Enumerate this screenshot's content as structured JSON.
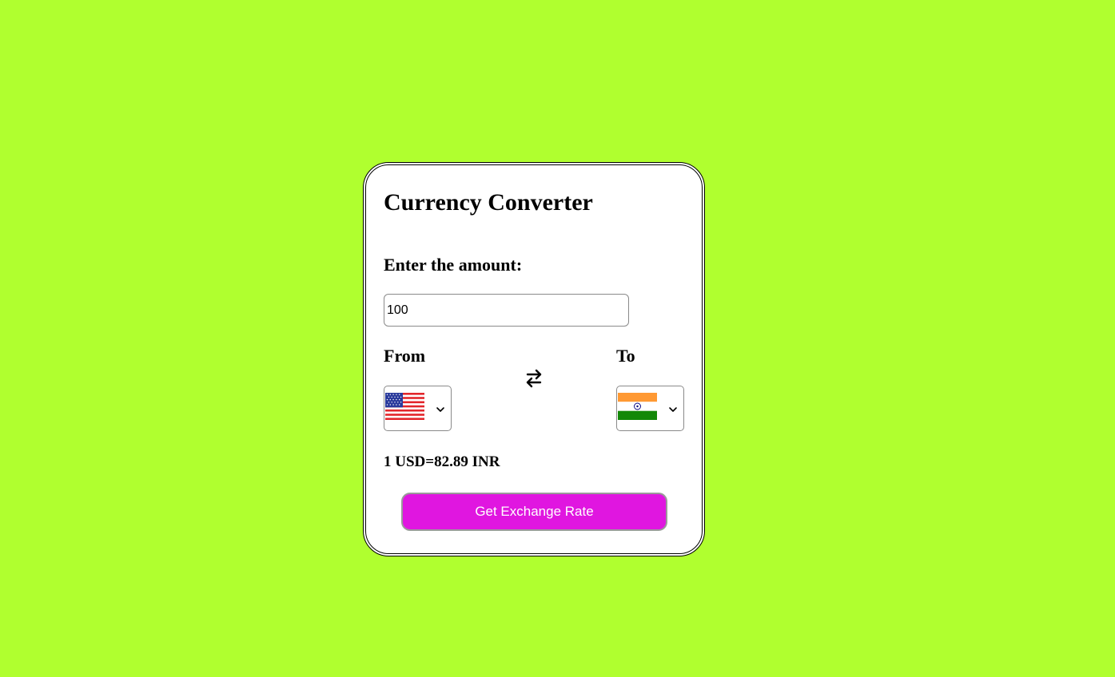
{
  "card": {
    "title": "Currency Converter",
    "amount_label": "Enter the amount:",
    "amount_value": "100",
    "from_label": "From",
    "to_label": "To",
    "from_currency": {
      "code": "USD",
      "flag_icon": "us-flag-icon"
    },
    "to_currency": {
      "code": "INR",
      "flag_icon": "india-flag-icon"
    },
    "swap_icon": "swap-arrows-icon",
    "rate_text": "1 USD=82.89 INR",
    "button_label": "Get Exchange Rate"
  },
  "colors": {
    "background": "#b0ff2f",
    "card": "#ffffff",
    "button": "#e016e0",
    "button_text": "#ffffff"
  }
}
